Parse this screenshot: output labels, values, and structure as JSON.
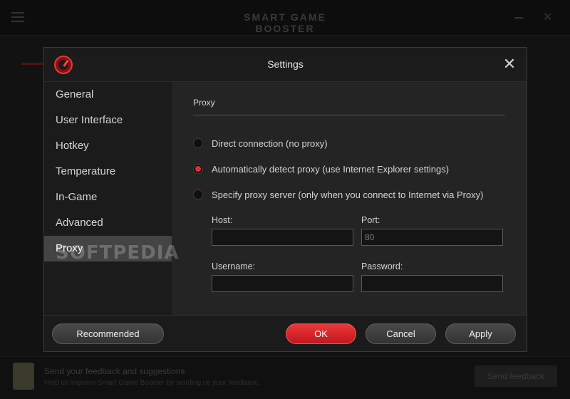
{
  "background": {
    "title": "SMART GAME BOOSTER",
    "footer_text_1": "Send your feedback and suggestions",
    "footer_text_2": "Help us improve Smart Game Booster by sending us your feedback.",
    "footer_button": "Send feedback"
  },
  "dialog": {
    "title": "Settings",
    "sidebar": {
      "items": [
        {
          "label": "General",
          "active": false
        },
        {
          "label": "User Interface",
          "active": false
        },
        {
          "label": "Hotkey",
          "active": false
        },
        {
          "label": "Temperature",
          "active": false
        },
        {
          "label": "In-Game",
          "active": false
        },
        {
          "label": "Advanced",
          "active": false
        },
        {
          "label": "Proxy",
          "active": true
        }
      ]
    },
    "proxy": {
      "section_title": "Proxy",
      "options": [
        {
          "label": "Direct connection (no proxy)",
          "checked": false
        },
        {
          "label": "Automatically detect proxy (use Internet Explorer settings)",
          "checked": true
        },
        {
          "label": "Specify proxy server (only when you connect to Internet via Proxy)",
          "checked": false
        }
      ],
      "host_label": "Host:",
      "host_value": "",
      "port_label": "Port:",
      "port_value": "80",
      "username_label": "Username:",
      "username_value": "",
      "password_label": "Password:",
      "password_value": ""
    },
    "buttons": {
      "recommended": "Recommended",
      "ok": "OK",
      "cancel": "Cancel",
      "apply": "Apply"
    }
  },
  "watermark": "SOFTPEDIA",
  "colors": {
    "accent": "#e8283a",
    "dialog_bg": "#242424",
    "sidebar_bg": "#1b1b1b",
    "active_item_bg": "#444444"
  }
}
